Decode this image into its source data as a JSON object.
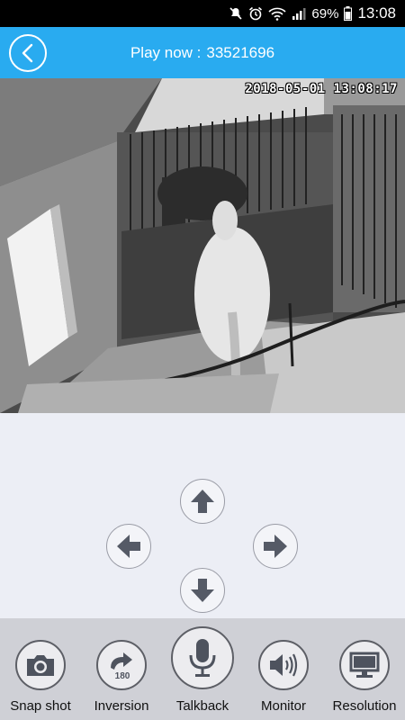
{
  "status_bar": {
    "battery": "69%",
    "time": "13:08",
    "icons": [
      "mute-icon",
      "alarm-icon",
      "wifi-icon",
      "signal-icon",
      "battery-icon"
    ]
  },
  "header": {
    "title_label": "Play now :",
    "device_id": "33521696",
    "back_icon": "back-icon",
    "accent_color": "#29abf0"
  },
  "video": {
    "timestamp": "2018-05-01 13:08:17"
  },
  "ptz": {
    "up_icon": "arrow-up-icon",
    "down_icon": "arrow-down-icon",
    "left_icon": "arrow-left-icon",
    "right_icon": "arrow-right-icon"
  },
  "toolbar": {
    "items": [
      {
        "label": "Snap shot",
        "icon": "camera-icon"
      },
      {
        "label": "Inversion",
        "icon": "rotate-180-icon",
        "badge": "180"
      },
      {
        "label": "Talkback",
        "icon": "microphone-icon"
      },
      {
        "label": "Monitor",
        "icon": "speaker-icon"
      },
      {
        "label": "Resolution",
        "icon": "monitor-icon"
      }
    ]
  }
}
